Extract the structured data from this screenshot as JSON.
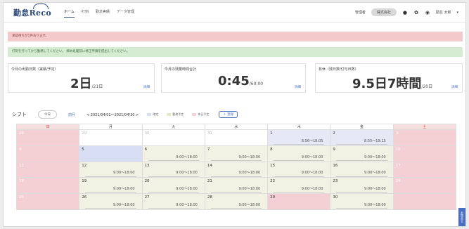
{
  "app": {
    "logo_text": "勤怠Reco",
    "nav": [
      "ホーム",
      "打刻",
      "勤怠実績",
      "データ管理"
    ],
    "active_nav": 0,
    "header_right": {
      "company": "管理者",
      "pill": "株式会社",
      "user": "勤怠 太郎"
    }
  },
  "alerts": {
    "red": "承認待ちが1件あります。",
    "green": "打刻を行ってから勤務してください。 締め処理前に修正申請を提出してください。"
  },
  "stats": [
    {
      "label": "今月の出勤日数（実績/予定）",
      "value": "2日",
      "sub": "/21日",
      "link": "詳細"
    },
    {
      "label": "今月の残業時間合計",
      "value": "0:45",
      "sub": "/60:00",
      "link": "詳細"
    },
    {
      "label": "有休（残日数/付与日数）",
      "value": "9.5日7時間",
      "sub": "/20日",
      "link": "詳細"
    }
  ],
  "toolbar": {
    "title": "シフト",
    "today_btn": "今日",
    "prev_link": "前月",
    "range": "< 2021/04/01〜2021/04/30 >",
    "legend": [
      {
        "label": "確定",
        "color": "#d7ddf2"
      },
      {
        "label": "勤務予定",
        "color": "#f1f1e4"
      },
      {
        "label": "休日予定",
        "color": "#f4d0d4"
      }
    ],
    "add_btn": "＋ 登録"
  },
  "calendar": {
    "headers": [
      "日",
      "月",
      "火",
      "水",
      "木",
      "金",
      "土"
    ],
    "weeks": [
      [
        {
          "d": "28",
          "t": "",
          "cls": "sun other"
        },
        {
          "d": "29",
          "t": "",
          "cls": "other"
        },
        {
          "d": "30",
          "t": "",
          "cls": "other"
        },
        {
          "d": "31",
          "t": "",
          "cls": "other"
        },
        {
          "d": "1",
          "t": "8:56〜18:05",
          "cls": "blue"
        },
        {
          "d": "2",
          "t": "8:55〜19:15",
          "cls": "blue"
        },
        {
          "d": "3",
          "t": "",
          "cls": "sat"
        }
      ],
      [
        {
          "d": "4",
          "t": "",
          "cls": "sun"
        },
        {
          "d": "5",
          "t": "",
          "cls": "today"
        },
        {
          "d": "6",
          "t": "9:00〜18:00",
          "cls": ""
        },
        {
          "d": "7",
          "t": "9:00〜18:00",
          "cls": ""
        },
        {
          "d": "8",
          "t": "9:00〜18:00",
          "cls": ""
        },
        {
          "d": "9",
          "t": "9:00〜18:00",
          "cls": ""
        },
        {
          "d": "10",
          "t": "",
          "cls": "sat"
        }
      ],
      [
        {
          "d": "11",
          "t": "",
          "cls": "sun"
        },
        {
          "d": "12",
          "t": "9:00〜18:00",
          "cls": ""
        },
        {
          "d": "13",
          "t": "9:00〜18:00",
          "cls": ""
        },
        {
          "d": "14",
          "t": "9:00〜18:00",
          "cls": ""
        },
        {
          "d": "15",
          "t": "9:00〜18:00",
          "cls": ""
        },
        {
          "d": "16",
          "t": "9:00〜18:00",
          "cls": ""
        },
        {
          "d": "17",
          "t": "",
          "cls": "sat"
        }
      ],
      [
        {
          "d": "18",
          "t": "",
          "cls": "sun"
        },
        {
          "d": "19",
          "t": "9:00〜18:00",
          "cls": ""
        },
        {
          "d": "20",
          "t": "9:00〜18:00",
          "cls": ""
        },
        {
          "d": "21",
          "t": "9:00〜18:00",
          "cls": ""
        },
        {
          "d": "22",
          "t": "9:00〜18:00",
          "cls": ""
        },
        {
          "d": "23",
          "t": "9:00〜18:00",
          "cls": ""
        },
        {
          "d": "24",
          "t": "",
          "cls": "sat"
        }
      ],
      [
        {
          "d": "25",
          "t": "",
          "cls": "sun"
        },
        {
          "d": "26",
          "t": "9:00〜18:00",
          "cls": ""
        },
        {
          "d": "27",
          "t": "9:00〜18:00",
          "cls": ""
        },
        {
          "d": "28",
          "t": "9:00〜18:00",
          "cls": ""
        },
        {
          "d": "29",
          "t": "",
          "cls": "holiday"
        },
        {
          "d": "30",
          "t": "9:00〜18:00",
          "cls": ""
        },
        {
          "d": "",
          "t": "",
          "cls": "sat"
        }
      ]
    ]
  },
  "side_tab": "お問合せ"
}
